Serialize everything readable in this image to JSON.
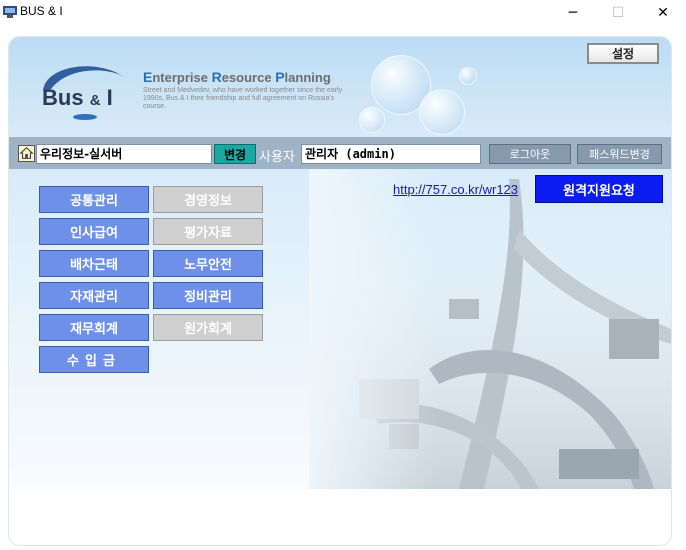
{
  "window": {
    "title": "BUS & I",
    "minimize_glyph": "─",
    "maximize_glyph": "☐",
    "close_glyph": "✕"
  },
  "header": {
    "logo_main": "Bus",
    "logo_amp": "&",
    "logo_end": "I",
    "erp_title_parts": [
      "E",
      "nterprise ",
      "R",
      "esource ",
      "P",
      "lanning"
    ],
    "erp_subtitle": "Street and Medvedev, who have worked together since the early 1990s, Bus & I their friendship and full agreement on Russia's course.",
    "settings_label": "설정"
  },
  "infobar": {
    "home_icon": "home-icon",
    "company_value": "우리정보-실서버",
    "change_label": "변경",
    "user_label": "사용자",
    "user_value": "관리자 (admin)",
    "logout_label": "로그아웃",
    "password_change_label": "패스워드변경"
  },
  "support": {
    "link_text": "http://757.co.kr/wr123",
    "remote_label": "원격지원요청"
  },
  "menu": {
    "left": [
      {
        "label": "공통관리",
        "state": "active"
      },
      {
        "label": "인사급여",
        "state": "active"
      },
      {
        "label": "배차근태",
        "state": "active"
      },
      {
        "label": "자재관리",
        "state": "active"
      },
      {
        "label": "재무회계",
        "state": "active"
      },
      {
        "label": "수입금",
        "state": "active"
      }
    ],
    "right": [
      {
        "label": "경영정보",
        "state": "disabled"
      },
      {
        "label": "평가자료",
        "state": "disabled"
      },
      {
        "label": "노무안전",
        "state": "active"
      },
      {
        "label": "정비관리",
        "state": "active"
      },
      {
        "label": "원가회계",
        "state": "disabled"
      }
    ]
  },
  "colors": {
    "menu_active": "#6e90e8",
    "menu_disabled": "#cfcfcf",
    "remote_button": "#0a1cf2",
    "change_button": "#19a9a0",
    "infobar": "#9fb3c6"
  }
}
